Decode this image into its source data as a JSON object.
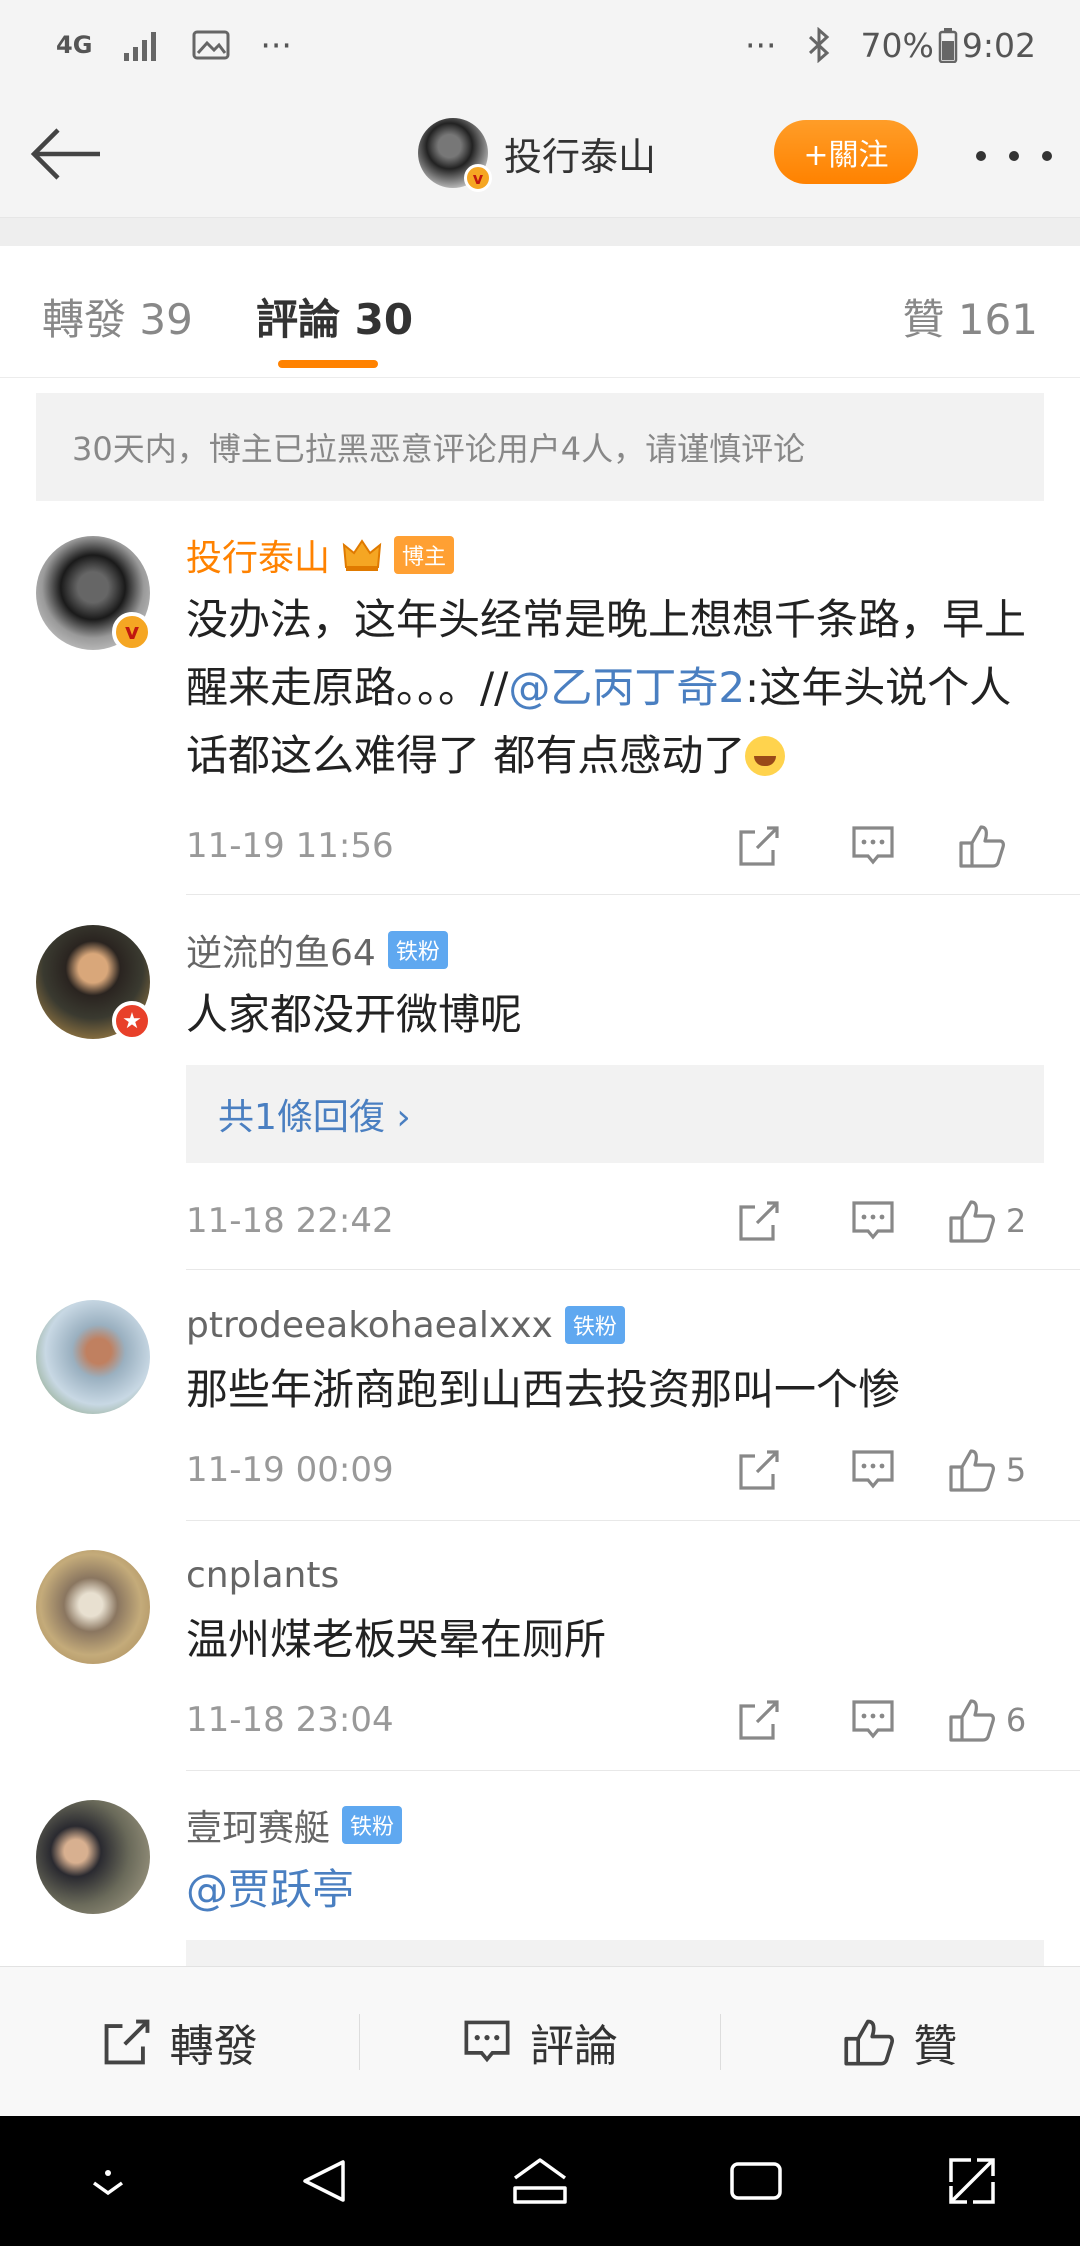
{
  "status_bar": {
    "network": "4G",
    "left_more": "···",
    "right_more": "···",
    "battery": "70%",
    "time": "9:02"
  },
  "nav": {
    "title": "投行泰山",
    "follow_label": "+關注"
  },
  "tabs": {
    "repost": "轉發 39",
    "comments": "評論 30",
    "likes": "贊 161"
  },
  "notice": "30天内，博主已拉黑恶意评论用户4人，请谨慎评论",
  "comments": [
    {
      "name": "投行泰山",
      "badge": "博主",
      "text_before": "没办法，这年头经常是晚上想想千条路，早上醒来走原路。。。//",
      "mention": "@乙丙丁奇2",
      "text_after": ":这年头说个人话都这么难得了 都有点感动了",
      "time": "11-19 11:56",
      "likes": ""
    },
    {
      "name": "逆流的鱼64",
      "badge": "铁粉",
      "text": "人家都没开微博呢",
      "reply_label": "共1條回復 ›",
      "time": "11-18 22:42",
      "likes": "2"
    },
    {
      "name": "ptrodeeakohaealxxx",
      "badge": "铁粉",
      "text": "那些年浙商跑到山西去投资那叫一个惨",
      "time": "11-19 00:09",
      "likes": "5"
    },
    {
      "name": "cnplants",
      "badge": "",
      "text": "温州煤老板哭晕在厕所",
      "time": "11-18 23:04",
      "likes": "6"
    },
    {
      "name": "壹珂赛艇",
      "badge": "铁粉",
      "mention": "@贾跃亭"
    }
  ],
  "bottom_bar": {
    "repost": "轉發",
    "comment": "評論",
    "like": "贊"
  },
  "colors": {
    "accent": "#ff8200",
    "link": "#4a7fc1",
    "fan_badge": "#5fa8f0"
  }
}
